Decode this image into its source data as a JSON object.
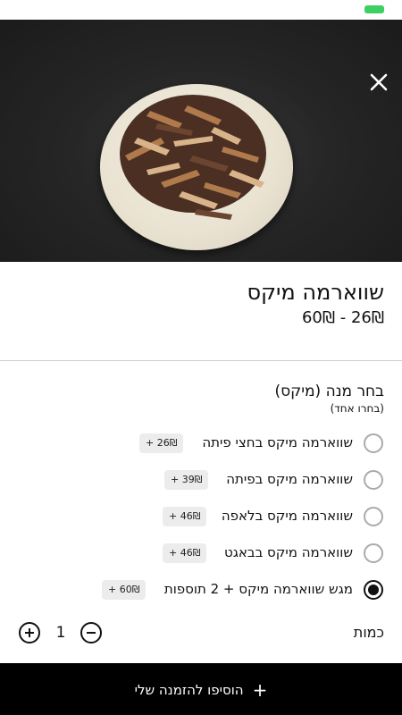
{
  "statusbar": {
    "battery_color": "#3dd061"
  },
  "hero": {
    "close_icon": "close-icon"
  },
  "product": {
    "title": "שווארמה מיקס",
    "price_range": "26₪ - 60₪"
  },
  "options_group": {
    "title": "בחר מנה (מיקס)",
    "subtitle": "(בחרו אחד)",
    "items": [
      {
        "label": "שווארמה מיקס בחצי פיתה",
        "price": "+ 26₪",
        "selected": false
      },
      {
        "label": "שווארמה מיקס בפיתה",
        "price": "+ 39₪",
        "selected": false
      },
      {
        "label": "שווארמה מיקס בלאפה",
        "price": "+ 46₪",
        "selected": false
      },
      {
        "label": "שווארמה מיקס בבאגט",
        "price": "+ 46₪",
        "selected": false
      },
      {
        "label": "מגש שווארמה מיקס + 2 תוספות",
        "price": "+ 60₪",
        "selected": true
      }
    ]
  },
  "quantity": {
    "label": "כמות",
    "value": "1"
  },
  "add_button": {
    "label": "הוסיפו להזמנה שלי",
    "icon": "+"
  }
}
